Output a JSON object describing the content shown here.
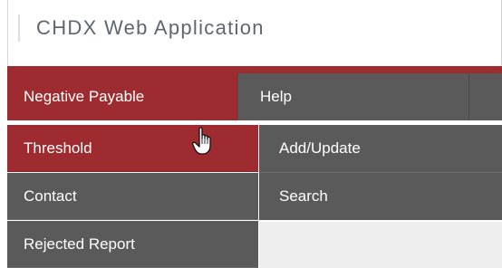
{
  "header": {
    "app_title": "CHDX Web Application"
  },
  "nav": {
    "items": [
      {
        "label": "Negative Payable",
        "active": true
      },
      {
        "label": "Help",
        "active": false
      }
    ]
  },
  "dropdown": {
    "items": [
      {
        "label": "Threshold",
        "active": true
      },
      {
        "label": "Contact",
        "active": false
      },
      {
        "label": "Rejected Report",
        "active": false
      }
    ]
  },
  "submenu": {
    "items": [
      {
        "label": "Add/Update"
      },
      {
        "label": "Search"
      }
    ]
  },
  "colors": {
    "accent_red": "#9e2b2f",
    "menu_gray": "#5a5a5a",
    "title_text": "#5f6670"
  },
  "icons": {
    "cursor": "hand-pointer-icon"
  }
}
